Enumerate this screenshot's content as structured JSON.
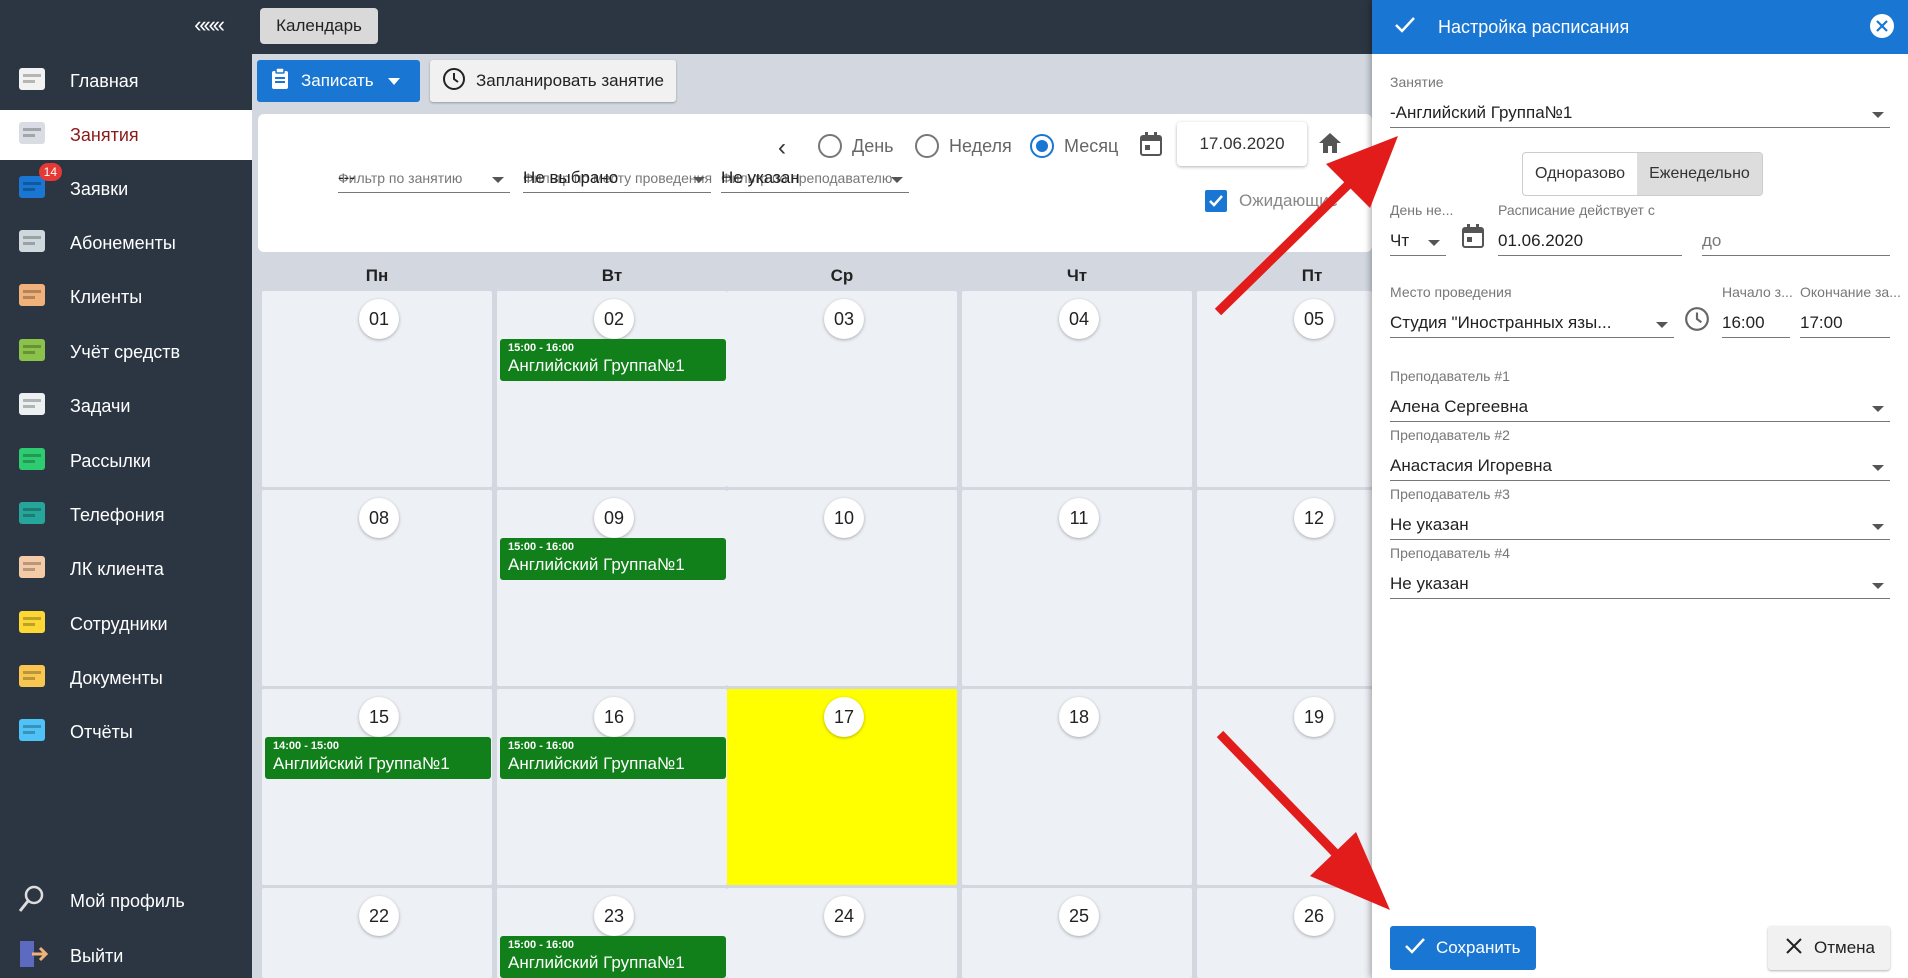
{
  "sidebar": {
    "collapse_label": "«««",
    "items": [
      {
        "label": "Главная",
        "icon": "home-icon"
      },
      {
        "label": "Занятия",
        "icon": "calendar-icon"
      },
      {
        "label": "Заявки",
        "icon": "requests-icon",
        "badge": "14"
      },
      {
        "label": "Абонементы",
        "icon": "subscription-card-icon"
      },
      {
        "label": "Клиенты",
        "icon": "clients-icon"
      },
      {
        "label": "Учёт средств",
        "icon": "money-icon"
      },
      {
        "label": "Задачи",
        "icon": "tasks-icon"
      },
      {
        "label": "Рассылки",
        "icon": "mailing-icon"
      },
      {
        "label": "Телефония",
        "icon": "phone-icon"
      },
      {
        "label": "ЛК клиента",
        "icon": "client-account-icon"
      },
      {
        "label": "Сотрудники",
        "icon": "staff-icon"
      },
      {
        "label": "Документы",
        "icon": "documents-icon"
      },
      {
        "label": "Отчёты",
        "icon": "reports-icon"
      }
    ],
    "bottom": [
      {
        "label": "Мой профиль",
        "icon": "profile-icon"
      },
      {
        "label": "Выйти",
        "icon": "logout-icon"
      }
    ]
  },
  "topbar": {
    "tab": "Календарь"
  },
  "toolbar": {
    "record_label": "Записать",
    "plan_label": "Запланировать занятие"
  },
  "view": {
    "modes": [
      "День",
      "Неделя",
      "Месяц"
    ],
    "selected": "Месяц",
    "date": "17.06.2020",
    "waiting_label": "Ожидающие"
  },
  "filters": [
    {
      "caption": "Фильтр по занятию",
      "value": "---"
    },
    {
      "caption": "Фильтр по месту проведения",
      "value": "Не выбрано"
    },
    {
      "caption": "Фильтр по преподавателю",
      "value": "Не указан"
    }
  ],
  "calendar": {
    "weekdays": [
      "Пн",
      "Вт",
      "Ср",
      "Чт",
      "Пт"
    ],
    "weeks": [
      [
        {
          "d": "01"
        },
        {
          "d": "02",
          "ev": {
            "time": "15:00 - 16:00",
            "name": "Английский Группа№1"
          }
        },
        {
          "d": "03"
        },
        {
          "d": "04"
        },
        {
          "d": "05"
        }
      ],
      [
        {
          "d": "08"
        },
        {
          "d": "09",
          "ev": {
            "time": "15:00 - 16:00",
            "name": "Английский Группа№1"
          }
        },
        {
          "d": "10"
        },
        {
          "d": "11"
        },
        {
          "d": "12"
        }
      ],
      [
        {
          "d": "15",
          "ev": {
            "time": "14:00 - 15:00",
            "name": "Английский Группа№1"
          }
        },
        {
          "d": "16",
          "ev": {
            "time": "15:00 - 16:00",
            "name": "Английский Группа№1"
          }
        },
        {
          "d": "17",
          "today": true
        },
        {
          "d": "18"
        },
        {
          "d": "19"
        }
      ],
      [
        {
          "d": "22"
        },
        {
          "d": "23",
          "ev": {
            "time": "15:00 - 16:00",
            "name": "Английский Группа№1"
          }
        },
        {
          "d": "24"
        },
        {
          "d": "25"
        },
        {
          "d": "26"
        }
      ]
    ],
    "today_color": "#ffff00",
    "event_color": "#11801a"
  },
  "panel": {
    "title": "Настройка расписания",
    "lesson": {
      "caption": "Занятие",
      "value": "-Английский Группа№1"
    },
    "frequency": {
      "options": [
        "Одноразово",
        "Еженедельно"
      ],
      "selected": "Еженедельно"
    },
    "day": {
      "caption": "День не...",
      "value": "Чт"
    },
    "valid_from": {
      "caption": "Расписание действует с",
      "value": "01.06.2020"
    },
    "valid_to": {
      "placeholder": "до"
    },
    "place": {
      "caption": "Место проведения",
      "value": "Студия \"Иностранных язы..."
    },
    "start": {
      "caption": "Начало з...",
      "value": "16:00"
    },
    "end": {
      "caption": "Окончание за...",
      "value": "17:00"
    },
    "teachers": [
      {
        "caption": "Преподаватель #1",
        "value": "Алена Сергеевна"
      },
      {
        "caption": "Преподаватель #2",
        "value": "Анастасия Игоревна"
      },
      {
        "caption": "Преподаватель #3",
        "value": "Не указан"
      },
      {
        "caption": "Преподаватель #4",
        "value": "Не указан"
      }
    ],
    "save_label": "Сохранить",
    "cancel_label": "Отмена"
  },
  "colors": {
    "accent": "#1976d2",
    "sidebar": "#2c3643",
    "arrow": "#e21b1b"
  }
}
